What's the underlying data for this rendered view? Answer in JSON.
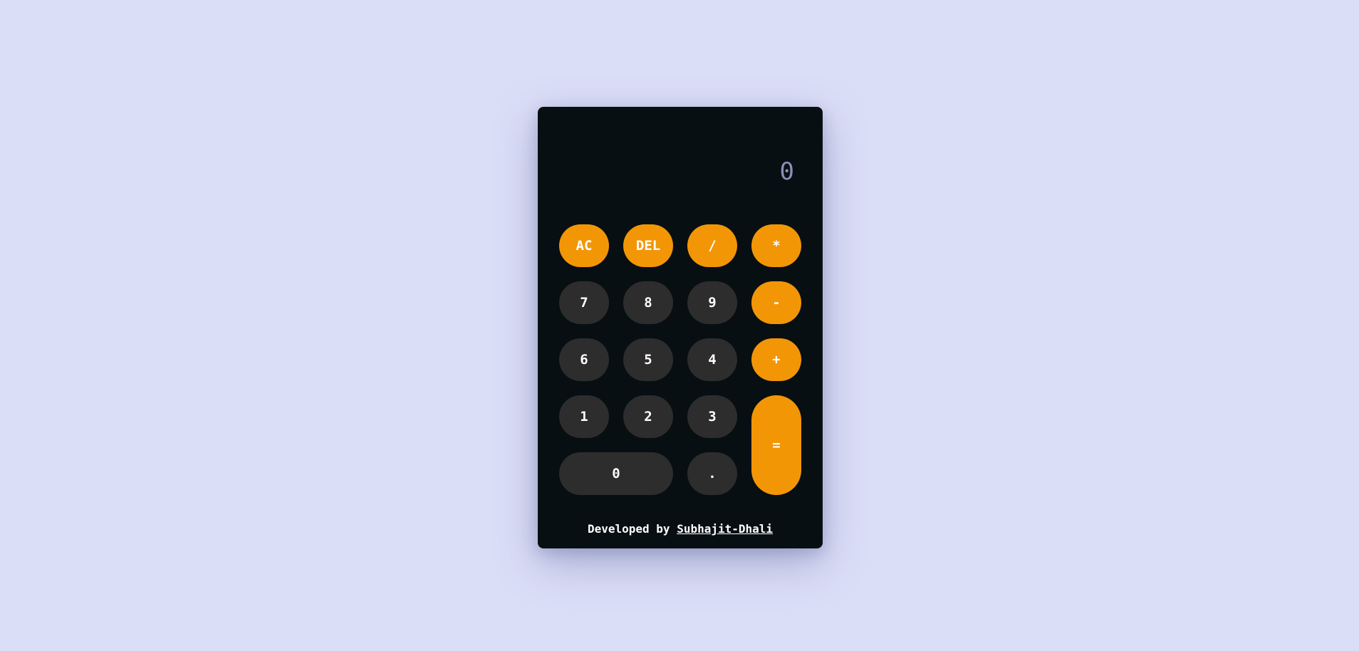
{
  "display": {
    "value": "0"
  },
  "keys": {
    "ac": "AC",
    "del": "DEL",
    "divide": "/",
    "multiply": "*",
    "seven": "7",
    "eight": "8",
    "nine": "9",
    "minus": "-",
    "six": "6",
    "five": "5",
    "four": "4",
    "plus": "+",
    "one": "1",
    "two": "2",
    "three": "3",
    "equals": "=",
    "zero": "0",
    "decimal": "."
  },
  "footer": {
    "prefix": "Developed by",
    "author": "Subhajit-Dhali"
  },
  "colors": {
    "background": "#dbdef7",
    "calculator": "#080f12",
    "operator": "#f39606",
    "number": "#2d2d2d",
    "display_text": "#8c8fb8"
  }
}
